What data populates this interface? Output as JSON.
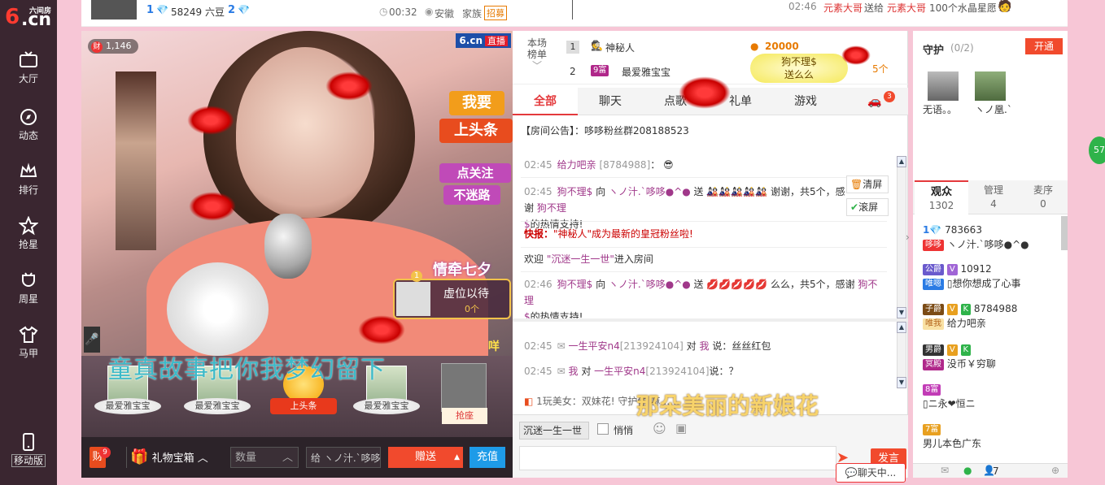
{
  "logo": {
    "six": "6",
    "cn": ".cn",
    "sub": "六间房"
  },
  "nav": [
    {
      "label": "大厅",
      "icon": "tv-icon"
    },
    {
      "label": "动态",
      "icon": "compass-icon"
    },
    {
      "label": "排行",
      "icon": "crown-icon"
    },
    {
      "label": "抢星",
      "icon": "star-icon"
    },
    {
      "label": "周星",
      "icon": "cup-icon"
    },
    {
      "label": "马甲",
      "icon": "shirt-icon"
    }
  ],
  "nav_mobile": "移动版",
  "topstrip": {
    "level1": "1",
    "beans": "58249 六豆",
    "level2": "2",
    "duration": "00:32",
    "location": "安徽",
    "family_label": "家族",
    "family_tag": "招募",
    "gift_time": "02:46",
    "gift_text_a": "元素大哥",
    "gift_mid": "送给",
    "gift_text_b": "元素大哥",
    "gift_tail": "100个水晶星愿"
  },
  "video": {
    "wealth": "1,146",
    "wealth_tag": "财",
    "brand": "6.cn",
    "live": "直播",
    "promo_top": "我要",
    "promo_top2": "上头条",
    "promo_follow": "点关注",
    "promo_lost": "不迷路",
    "love_title": "情牵七夕",
    "seat_label": "虚位以待",
    "seat_count": "0个",
    "seat_rank": "1",
    "scroll_text": "童真故事把你我梦幻留下",
    "side_tag": "咩"
  },
  "seats": [
    {
      "name": "最爱雅宝宝"
    },
    {
      "name": "最爱雅宝宝"
    },
    {
      "name": "上头条"
    },
    {
      "name": "最爱雅宝宝"
    },
    {
      "name": "抢座"
    }
  ],
  "bottombar": {
    "cai": "财",
    "cai_count": "9",
    "gift_box": "礼物宝箱",
    "qty_placeholder": "数量",
    "to_label": "给",
    "to_name": "ヽノ汁.`哆哆",
    "give": "赠送",
    "recharge": "充值"
  },
  "rank": {
    "label_a": "本场",
    "label_b": "榜单",
    "rows": [
      {
        "pos": "1",
        "name": "神秘人",
        "value": "20000"
      },
      {
        "pos": "2",
        "name": "最爱雅宝宝",
        "badge": "9富",
        "value": ""
      }
    ],
    "float_name": "狗不理$",
    "float_action": "送么么",
    "float_count": "5个"
  },
  "tabs": [
    "全部",
    "聊天",
    "点歌",
    "礼单",
    "游戏"
  ],
  "tab_badge": "3",
  "notice": {
    "label": "【房间公告】：",
    "text": "哆哆粉丝群208188523"
  },
  "chat_tools": {
    "clear": "清屏",
    "scroll": "滚屏"
  },
  "messages": {
    "m1": {
      "time": "02:45",
      "name": "给力吧亲",
      "id": "[8784988]",
      "tail": "："
    },
    "m2": {
      "time": "02:45",
      "name": "狗不理$",
      "to": "向",
      "target": "ヽノ汁.`哆哆●^●",
      "send": "送",
      "thanks": "谢谢，共5个，感谢",
      "name2": "狗不理",
      "tail2": "$",
      "tail3": "的热情支持!"
    },
    "m3": {
      "label": "快报：",
      "text": "\"神秘人\"成为最新的皇冠粉丝啦!"
    },
    "m4": {
      "pre": "欢迎",
      "name": "\"沉迷一生一世\"",
      "post": "进入房间"
    },
    "m5": {
      "time": "02:46",
      "name": "狗不理$",
      "to": "向",
      "target": "ヽノ汁.`哆哆●^●",
      "send": "送",
      "thanks": "么么，共5个，感谢",
      "name2": "狗不理",
      "tail2": "$",
      "tail3": "的热情支持!"
    },
    "m6": {
      "time": "02:45",
      "name": "一生平安n4",
      "id": "[213924104]",
      "to": "对",
      "me": "我",
      "say": "说：丝丝红包"
    },
    "m7": {
      "time": "02:45",
      "me": "我",
      "to": "对",
      "name": "一生平安n4",
      "id": "[213924104]",
      "say": "说：？"
    },
    "m8": {
      "text": "1玩美女：双妹花! 守护你 嘛……"
    }
  },
  "chatinput": {
    "target": "沉迷一生一世",
    "quiet": "悄悄",
    "send": "发言"
  },
  "chat_min": "聊天中...",
  "song_overlay": "那朵美丽的新娘花",
  "guard": {
    "title": "守护",
    "count": "(0/2)",
    "open": "开通",
    "users": [
      "无语。。",
      "ヽノ凰.`"
    ]
  },
  "right_tabs": [
    {
      "label": "观众",
      "count": "1302"
    },
    {
      "label": "管理",
      "count": "4"
    },
    {
      "label": "麦序",
      "count": "0"
    }
  ],
  "users": [
    {
      "level": "1",
      "id": "783663",
      "badge": "哆哆",
      "name": "ヽノ汁.`哆哆●^●"
    },
    {
      "badge_top": "公爵",
      "id": "10912",
      "badge": "唯嗯",
      "name": "想你想成了心事"
    },
    {
      "badge_top": "子爵",
      "id": "8784988",
      "badge": "唯我",
      "name": "给力吧亲"
    },
    {
      "badge_top": "男爵",
      "id": "",
      "badge": "冥殿",
      "name": "没币￥穷聊"
    },
    {
      "badge_top": "8富",
      "id": "",
      "badge": "",
      "name": "ニ永❤恒ニ"
    },
    {
      "badge_top": "7富",
      "id": "",
      "badge": "",
      "name": "男儿本色广东"
    }
  ],
  "right_footer": {
    "count": "7"
  },
  "float_badge": "57"
}
